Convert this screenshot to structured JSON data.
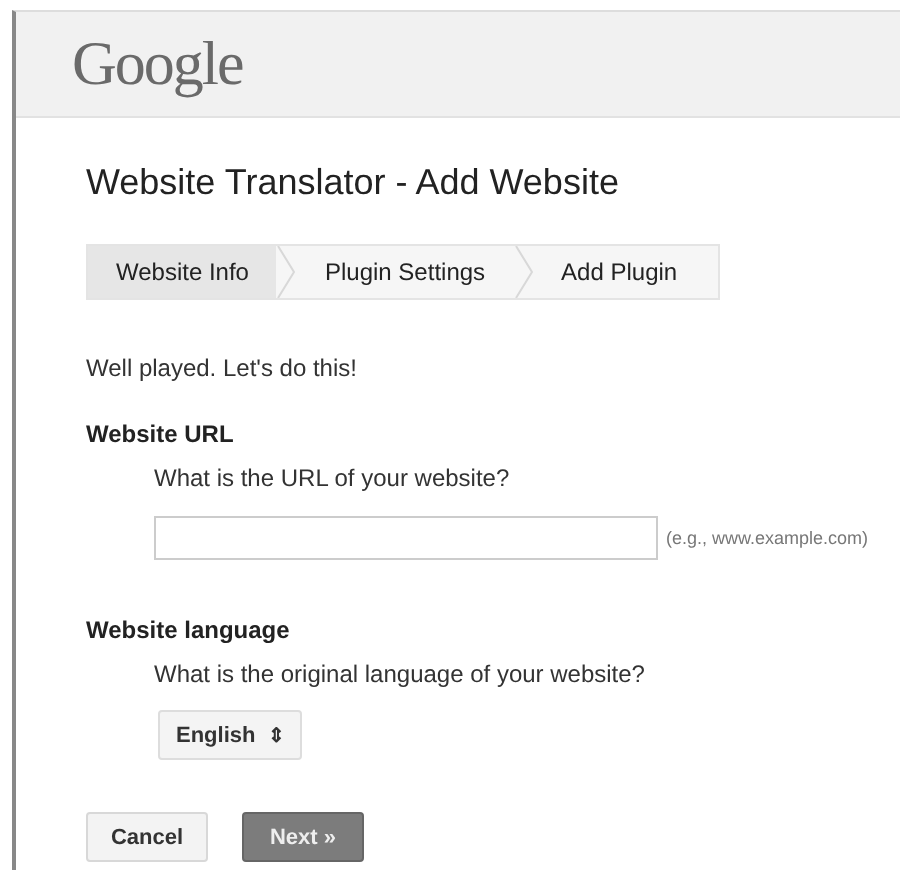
{
  "header": {
    "logo": "Google"
  },
  "title": "Website Translator - Add Website",
  "steps": [
    {
      "label": "Website Info",
      "selected": true
    },
    {
      "label": "Plugin Settings",
      "selected": false
    },
    {
      "label": "Add Plugin",
      "selected": false
    }
  ],
  "intro": "Well played. Let's do this!",
  "url_section": {
    "heading": "Website URL",
    "question": "What is the URL of your website?",
    "hint": "(e.g., www.example.com)"
  },
  "language_section": {
    "heading": "Website language",
    "question": "What is the original language of your website?",
    "select": {
      "value": "English",
      "arrow": "⇕"
    }
  },
  "buttons": [
    {
      "label": "Cancel",
      "kind": "secondary"
    },
    {
      "label": "Next »",
      "kind": "primary"
    }
  ]
}
